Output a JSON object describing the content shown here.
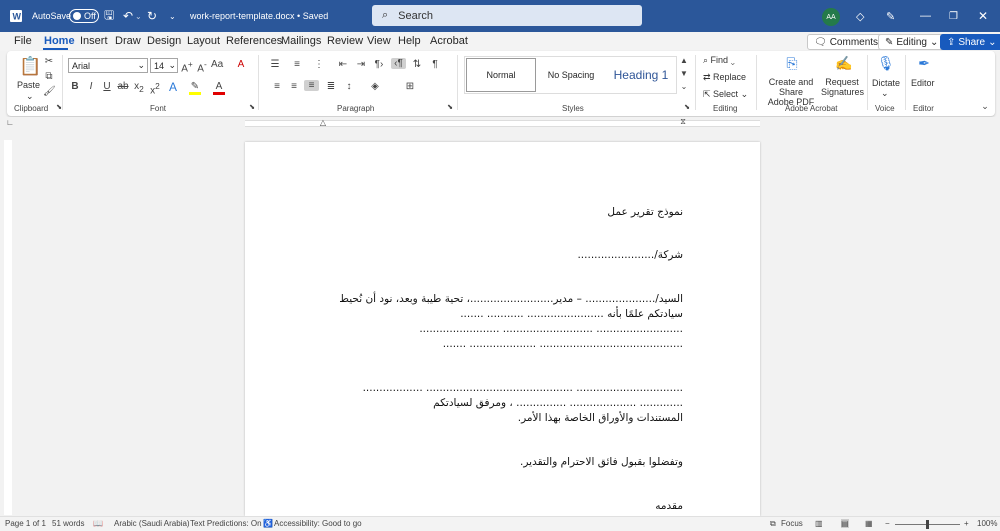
{
  "titlebar": {
    "autosave_label": "AutoSave",
    "autosave_state": "Off",
    "doc_title": "work-report-template.docx • Saved",
    "search_placeholder": "Search",
    "avatar_initials": "AA",
    "color": "#2b579a"
  },
  "menu": {
    "items": [
      "File",
      "Home",
      "Insert",
      "Draw",
      "Design",
      "Layout",
      "References",
      "Mailings",
      "Review",
      "View",
      "Help",
      "Acrobat"
    ],
    "active": "Home",
    "comments": "Comments",
    "editing": "Editing",
    "share": "Share"
  },
  "ribbon": {
    "clipboard": {
      "paste": "Paste",
      "label": "Clipboard"
    },
    "font": {
      "name": "Arial",
      "size": "14",
      "label": "Font"
    },
    "paragraph": {
      "label": "Paragraph"
    },
    "styles": {
      "items": [
        "Normal",
        "No Spacing",
        "Heading 1"
      ],
      "label": "Styles"
    },
    "editing": {
      "find": "Find",
      "replace": "Replace",
      "select": "Select",
      "label": "Editing"
    },
    "acrobat": {
      "create": "Create and Share",
      "create2": "Adobe PDF",
      "request": "Request",
      "request2": "Signatures",
      "label": "Adobe Acrobat"
    },
    "voice": {
      "dictate": "Dictate",
      "label": "Voice"
    },
    "editor": {
      "editor": "Editor",
      "label": "Editor"
    }
  },
  "document": {
    "lines": [
      "نموذج تقرير عمل",
      "شركة/.......................",
      "السيد/.....................  – مدير.........................، تحية طيبة وبعد، نود أن نُحيط",
      "سيادتكم علمًا بأنه ....................... ........... .......",
      ".......................... ........................... ........................",
      "........................................... .................... .......",
      "................................ ............................................ ..................",
      "............. .................... ............... ، ومرفق لسيادتكم",
      "المستندات والأوراق الخاصة بهذا الأمر.",
      "وتفضلوا بقبول فائق الاحترام والتقدير.",
      "مقدمه"
    ]
  },
  "status": {
    "page": "Page 1 of 1",
    "words": "51 words",
    "language": "Arabic (Saudi Arabia)",
    "predictions": "Text Predictions: On",
    "accessibility": "Accessibility: Good to go",
    "focus": "Focus",
    "zoom": "100%"
  }
}
